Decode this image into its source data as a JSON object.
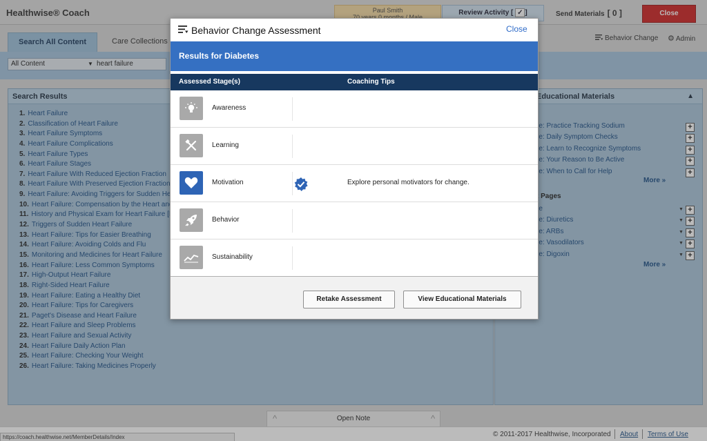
{
  "app": {
    "title": "Healthwise® Coach",
    "patient_name": "Paul Smith",
    "patient_info": "70 years 0 months / Male",
    "review_label": "Review Activity [",
    "review_check": "✓",
    "review_close": "]",
    "send_label": "Send Materials",
    "send_count": "[ 0 ]",
    "close_label": "Close"
  },
  "nav": {
    "tabs": [
      {
        "label": "Search All Content",
        "active": true
      },
      {
        "label": "Care Collections",
        "active": false
      }
    ],
    "behavior_change_label": "Behavior Change",
    "admin_label": "Admin"
  },
  "search": {
    "content_filter": "All Content",
    "query": "heart failure"
  },
  "search_results": {
    "title": "Search Results",
    "items": [
      {
        "num": "1.",
        "label": "Heart Failure"
      },
      {
        "num": "2.",
        "label": "Classification of Heart Failure"
      },
      {
        "num": "3.",
        "label": "Heart Failure Symptoms"
      },
      {
        "num": "4.",
        "label": "Heart Failure Complications"
      },
      {
        "num": "5.",
        "label": "Heart Failure Types"
      },
      {
        "num": "6.",
        "label": "Heart Failure Stages"
      },
      {
        "num": "7.",
        "label": "Heart Failure With Reduced Ejection Fraction"
      },
      {
        "num": "8.",
        "label": "Heart Failure With Preserved Ejection Fraction"
      },
      {
        "num": "9.",
        "label": "Heart Failure: Avoiding Triggers for Sudden He"
      },
      {
        "num": "10.",
        "label": "Heart Failure: Compensation by the Heart and"
      },
      {
        "num": "11.",
        "label": "History and Physical Exam for Heart Failure [M"
      },
      {
        "num": "12.",
        "label": "Triggers of Sudden Heart Failure"
      },
      {
        "num": "13.",
        "label": "Heart Failure: Tips for Easier Breathing"
      },
      {
        "num": "14.",
        "label": "Heart Failure: Avoiding Colds and Flu"
      },
      {
        "num": "15.",
        "label": "Monitoring and Medicines for Heart Failure"
      },
      {
        "num": "16.",
        "label": "Heart Failure: Less Common Symptoms"
      },
      {
        "num": "17.",
        "label": "High-Output Heart Failure"
      },
      {
        "num": "18.",
        "label": "Right-Sided Heart Failure"
      },
      {
        "num": "19.",
        "label": "Heart Failure: Eating a Healthy Diet"
      },
      {
        "num": "20.",
        "label": "Heart Failure: Tips for Caregivers"
      },
      {
        "num": "21.",
        "label": "Paget's Disease and Heart Failure"
      },
      {
        "num": "22.",
        "label": "Heart Failure and Sleep Problems"
      },
      {
        "num": "23.",
        "label": "Heart Failure and Sexual Activity"
      },
      {
        "num": "24.",
        "label": "Heart Failure Daily Action Plan"
      },
      {
        "num": "25.",
        "label": "Heart Failure: Checking Your Weight"
      },
      {
        "num": "26.",
        "label": "Heart Failure: Taking Medicines Properly"
      }
    ]
  },
  "right_panel": {
    "title": "Educational Materials",
    "materials": [
      "re: Practice Tracking Sodium",
      "re: Daily Symptom Checks",
      "re: Learn to Recognize Symptoms",
      "re: Your Reason to Be Active",
      "re: When to Call for Help"
    ],
    "more_label": "More »",
    "subheading": "t Pages",
    "pages": [
      "re",
      "re: Diuretics",
      "re: ARBs",
      "re: Vasodilators",
      "re: Digoxin"
    ],
    "more_label_2": "More »"
  },
  "modal": {
    "title": "Behavior Change Assessment",
    "close_label": "Close",
    "results_label": "Results for Diabetes",
    "col_stage": "Assessed Stage(s)",
    "col_tips": "Coaching Tips",
    "stages": [
      {
        "label": "Awareness",
        "icon": "lightbulb-icon",
        "tip": ""
      },
      {
        "label": "Learning",
        "icon": "tools-icon",
        "tip": ""
      },
      {
        "label": "Motivation",
        "icon": "heart-icon",
        "tip": "Explore personal motivators for change.",
        "assessed": true
      },
      {
        "label": "Behavior",
        "icon": "rocket-icon",
        "tip": ""
      },
      {
        "label": "Sustainability",
        "icon": "trend-line-icon",
        "tip": ""
      }
    ],
    "retake_label": "Retake Assessment",
    "view_materials_label": "View Educational Materials"
  },
  "bottom": {
    "open_note": "Open Note",
    "status_url": "https://coach.healthwise.net/MemberDetails/Index",
    "copyright": "© 2011-2017 Healthwise, Incorporated",
    "about": "About",
    "terms": "Terms of Use"
  },
  "colors": {
    "accent": "#3570c2",
    "table_header": "#17385f",
    "close_red": "#cf2424"
  }
}
